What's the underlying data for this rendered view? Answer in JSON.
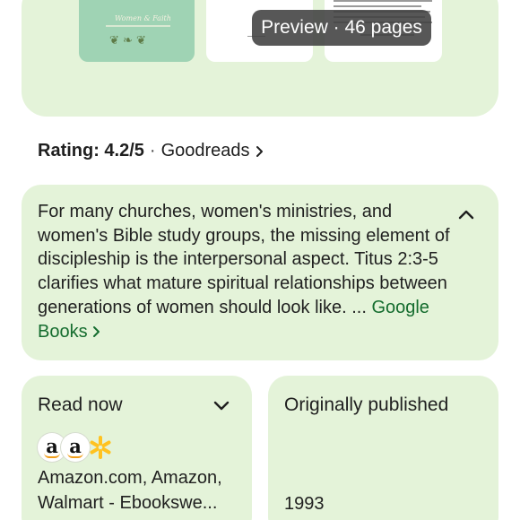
{
  "preview": {
    "cover_title": "Women & Faith",
    "pill_label": "Preview · 46 pages"
  },
  "rating": {
    "label": "Rating: 4.2/5",
    "separator": "·",
    "source": "Goodreads"
  },
  "description": {
    "text": "For many churches, women's ministries, and women's Bible study groups, the missing element of discipleship is the interpersonal aspect. Titus 2:3-5 clarifies what mature spiritual relationships between generations of women should look like. ... ",
    "link_label": "Google Books",
    "collapse_icon": "chevron-up-icon"
  },
  "read_now": {
    "title": "Read now",
    "expand_icon": "chevron-down-icon",
    "stores": [
      "amazon-icon",
      "amazon-icon",
      "walmart-icon"
    ],
    "store_text": "Amazon.com, Amazon, Walmart - Ebookswe..."
  },
  "originally_published": {
    "title": "Originally published",
    "year": "1993"
  },
  "colors": {
    "card_bg": "#e4f3d9",
    "link_green": "#146c2e",
    "pill_bg": "#404040",
    "walmart_yellow": "#ffc220",
    "amazon_orange": "#f19e1a"
  }
}
